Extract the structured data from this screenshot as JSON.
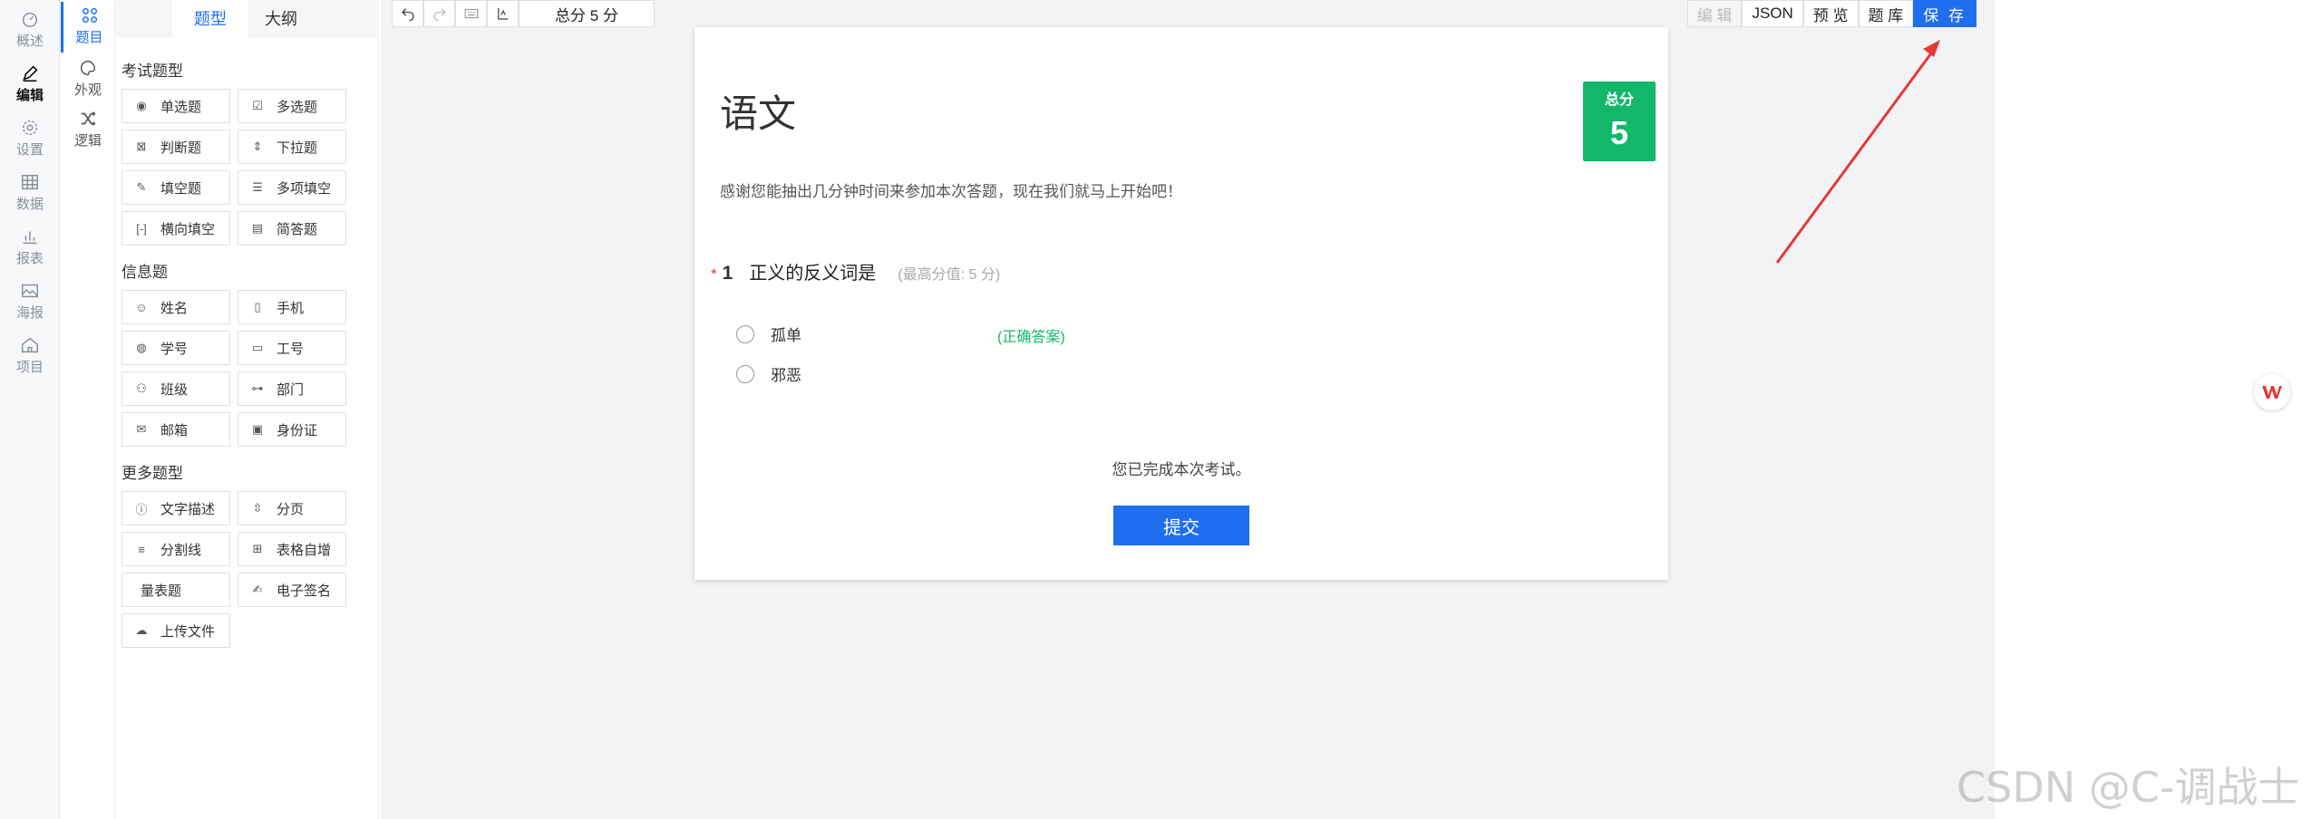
{
  "leftnav": [
    {
      "label": "概述",
      "icon": "gauge-icon"
    },
    {
      "label": "编辑",
      "icon": "pen-icon",
      "active": true
    },
    {
      "label": "设置",
      "icon": "gear-icon"
    },
    {
      "label": "数据",
      "icon": "table-icon"
    },
    {
      "label": "报表",
      "icon": "bar-chart-icon"
    },
    {
      "label": "海报",
      "icon": "image-icon"
    },
    {
      "label": "项目",
      "icon": "home-icon"
    }
  ],
  "subnav": [
    {
      "label": "题目",
      "icon": "grid-icon",
      "active": true
    },
    {
      "label": "外观",
      "icon": "palette-icon"
    },
    {
      "label": "逻辑",
      "icon": "shuffle-icon"
    }
  ],
  "palette": {
    "tab_types": "题型",
    "tab_outline": "大纲",
    "exam_section": "考试题型",
    "exam_items": [
      "单选题",
      "多选题",
      "判断题",
      "下拉题",
      "填空题",
      "多项填空",
      "横向填空",
      "简答题"
    ],
    "info_section": "信息题",
    "info_items": [
      "姓名",
      "手机",
      "学号",
      "工号",
      "班级",
      "部门",
      "邮箱",
      "身份证"
    ],
    "more_section": "更多题型",
    "more_items": [
      "文字描述",
      "分页",
      "分割线",
      "表格自增",
      "量表题",
      "电子签名",
      "上传文件"
    ]
  },
  "toolbar": {
    "score": "总分 5 分",
    "edit": "编 辑",
    "json": "JSON",
    "preview": "预 览",
    "bank": "题 库",
    "save": "保 存"
  },
  "paper": {
    "title": "语文",
    "score_label": "总分",
    "score_value": "5",
    "description": "感谢您能抽出几分钟时间来参加本次答题，现在我们就马上开始吧！",
    "question": {
      "required_mark": "*",
      "number": "1",
      "text": "正义的反义词是",
      "max": "(最高分值: 5 分)",
      "options": [
        "孤单",
        "邪恶"
      ],
      "correct_label": "(正确答案)"
    },
    "done_text": "您已完成本次考试。",
    "submit": "提交"
  },
  "watermark": "CSDN @C-调战士",
  "colors": {
    "accent": "#1f6ef0",
    "score": "#12b76a",
    "arrow": "#e53935"
  }
}
